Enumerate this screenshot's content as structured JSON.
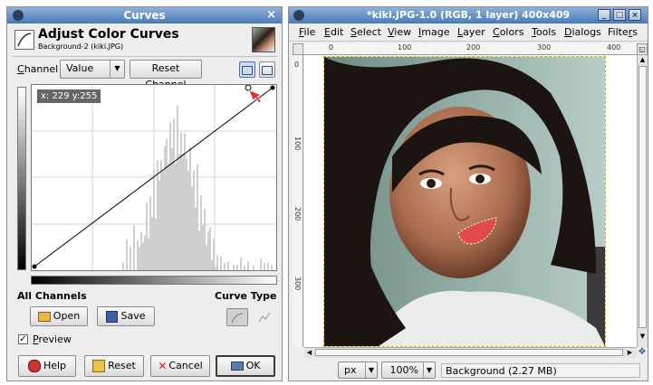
{
  "curves_dialog": {
    "title": "Curves",
    "close_glyph": "×",
    "header_title": "Adjust Color Curves",
    "header_subtitle": "Background-2 (kiki.JPG)",
    "channel_label": "Channel",
    "channel_value": "Value",
    "reset_channel_label": "Reset Channel",
    "coord_readout": "x: 229 y:255",
    "all_channels_label": "All Channels",
    "curve_type_label": "Curve Type",
    "open_label": "Open",
    "save_label": "Save",
    "preview_label": "Preview",
    "preview_checked": true,
    "help_label": "Help",
    "reset_label": "Reset",
    "cancel_label": "Cancel",
    "ok_label": "OK",
    "icons": [
      "wilber-icon",
      "thumbnail-icon",
      "dropdown-arrow-icon",
      "linear-histogram-icon",
      "log-histogram-icon",
      "open-folder-icon",
      "save-floppy-icon",
      "smooth-curve-icon",
      "freehand-curve-icon",
      "help-icon",
      "reset-icon",
      "cancel-icon",
      "ok-icon",
      "pointer-arrow-icon"
    ]
  },
  "image_window": {
    "title": "*kiki.JPG-1.0 (RGB, 1 layer) 400x409",
    "window_buttons": [
      "_",
      "□",
      "×"
    ],
    "menu": [
      "File",
      "Edit",
      "Select",
      "View",
      "Image",
      "Layer",
      "Colors",
      "Tools",
      "Dialogs",
      "Filters"
    ],
    "ruler_labels": [
      "0",
      "100",
      "200",
      "300",
      "400"
    ],
    "vruler_labels": [
      "0",
      "100",
      "200",
      "300"
    ],
    "unit_value": "px",
    "zoom_value": "100%",
    "status_text": "Background (2.27 MB)"
  },
  "colors": {
    "titlebar": "#4a7ab8",
    "selection_red": "#e53c3c",
    "histogram": "#c8c8c8"
  }
}
